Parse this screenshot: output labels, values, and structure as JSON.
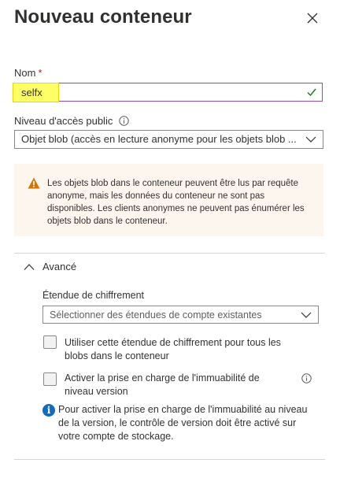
{
  "panel": {
    "title": "Nouveau conteneur"
  },
  "name": {
    "label": "Nom",
    "required_mark": "*",
    "value": "selfx"
  },
  "access": {
    "label": "Niveau d'accès public",
    "selected": "Objet blob (accès en lecture anonyme pour les objets blob ..."
  },
  "warning": {
    "text": "Les objets blob dans le conteneur peuvent être lus par requête anonyme, mais les données du conteneur ne sont pas disponibles. Les clients anonymes ne peuvent pas énumérer les objets blob dans le conteneur."
  },
  "advanced": {
    "label": "Avancé",
    "encryption_label": "Étendue de chiffrement",
    "encryption_placeholder": "Sélectionner des étendues de compte existantes",
    "use_scope_label": "Utiliser cette étendue de chiffrement pour tous les blobs dans le conteneur",
    "immutability_label": "Activer la prise en charge de l'immuabilité de niveau version",
    "immutability_note": "Pour activer la prise en charge de l'immuabilité au niveau de la version, le contrôle de version doit être activé sur votre compte de stockage."
  },
  "colors": {
    "accent": "#8a4fb3",
    "warning": "#d47500",
    "info": "#0f6cbd",
    "success": "#107c10"
  }
}
